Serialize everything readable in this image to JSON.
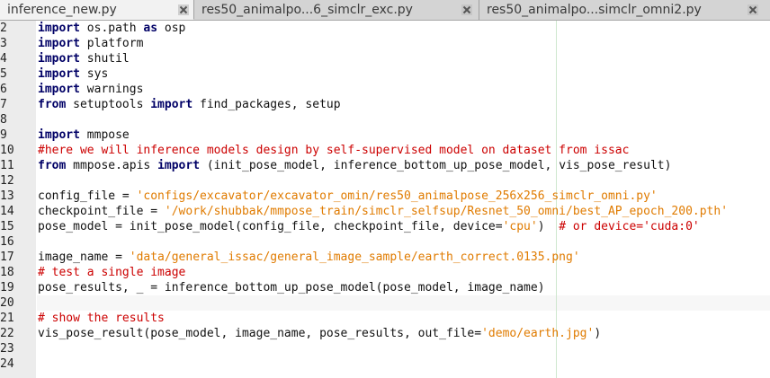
{
  "tabs": [
    {
      "label": "inference_new.py",
      "active": true
    },
    {
      "label": "res50_animalpo...6_simclr_exc.py",
      "active": false
    },
    {
      "label": "res50_animalpo...simclr_omni2.py",
      "active": false
    }
  ],
  "line_numbers": [
    "2",
    "3",
    "4",
    "5",
    "6",
    "7",
    "8",
    "9",
    "10",
    "11",
    "12",
    "13",
    "14",
    "15",
    "16",
    "17",
    "18",
    "19",
    "20",
    "21",
    "22",
    "23",
    "24"
  ],
  "code": {
    "l2": {
      "kw": "import",
      "rest": " os.path ",
      "kw2": "as",
      "rest2": " osp"
    },
    "l3": {
      "kw": "import",
      "rest": " platform"
    },
    "l4": {
      "kw": "import",
      "rest": " shutil"
    },
    "l5": {
      "kw": "import",
      "rest": " sys"
    },
    "l6": {
      "kw": "import",
      "rest": " warnings"
    },
    "l7": {
      "kw": "from",
      "rest": " setuptools ",
      "kw2": "import",
      "rest2": " find_packages, setup"
    },
    "l9": {
      "kw": "import",
      "rest": " mmpose"
    },
    "l10": {
      "comment": "#here we will inference models design by self-supervised model on dataset from issac"
    },
    "l11": {
      "kw": "from",
      "rest": " mmpose.apis ",
      "kw2": "import",
      "rest2": " (init_pose_model, inference_bottom_up_pose_model, vis_pose_result)"
    },
    "l13": {
      "pre": "config_file = ",
      "str": "'configs/excavator/excavator_omin/res50_animalpose_256x256_simclr_omni.py'"
    },
    "l14": {
      "pre": "checkpoint_file = ",
      "str": "'/work/shubbak/mmpose_train/simclr_selfsup/Resnet_50_omni/best_AP_epoch_200.pth'"
    },
    "l15": {
      "pre": "pose_model = init_pose_model(config_file, checkpoint_file, device=",
      "str": "'cpu'",
      "post": ")  ",
      "comment": "# or device='cuda:0'"
    },
    "l17": {
      "pre": "image_name = ",
      "str": "'data/general_issac/general_image_sample/earth_correct.0135.png'"
    },
    "l18": {
      "comment": "# test a single image"
    },
    "l19": {
      "pre": "pose_results, _ = inference_bottom_up_pose_model(pose_model, image_name)"
    },
    "l21": {
      "comment": "# show the results"
    },
    "l22": {
      "pre": "vis_pose_result(pose_model, image_name, pose_results, out_file=",
      "str": "'demo/earth.jpg'",
      "post": ")"
    }
  },
  "colors": {
    "keyword": "#000066",
    "comment": "#cc0000",
    "string": "#e07b00"
  }
}
